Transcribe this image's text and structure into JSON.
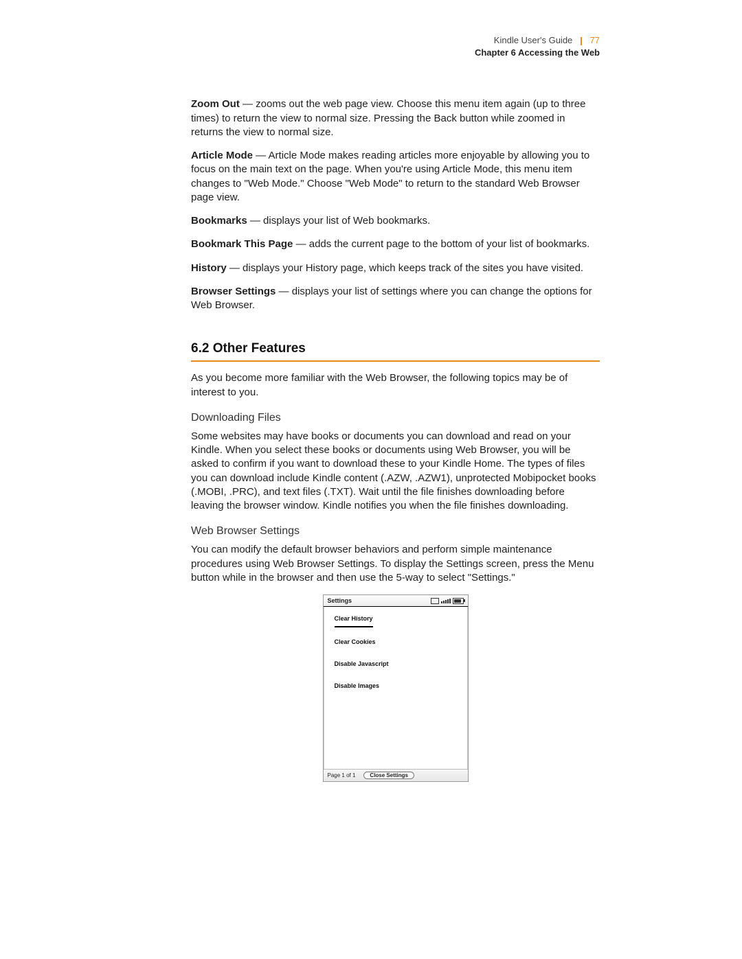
{
  "header": {
    "guide": "Kindle User's Guide",
    "page_number": "77",
    "chapter": "Chapter 6 Accessing the Web"
  },
  "definitions": {
    "zoom_out": {
      "term": "Zoom Out",
      "text": " — zooms out the web page view. Choose this menu item again (up to three times) to return the view to normal size. Pressing the Back button while zoomed in returns the view to normal size."
    },
    "article_mode": {
      "term": "Article Mode",
      "text": " — Article Mode makes reading articles more enjoyable by allowing you to focus on the main text on the page. When you're using Article Mode, this menu item changes to \"Web Mode.\" Choose \"Web Mode\" to return to the standard Web Browser page view."
    },
    "bookmarks": {
      "term": "Bookmarks",
      "text": " — displays your list of Web bookmarks."
    },
    "bookmark_this": {
      "term": "Bookmark This Page",
      "text": " — adds the current page to the bottom of your list of bookmarks."
    },
    "history": {
      "term": "History",
      "text": " — displays your History page, which keeps track of the sites you have visited."
    },
    "browser_settings": {
      "term": "Browser Settings",
      "text": " — displays your list of settings where you can change the options for Web Browser."
    }
  },
  "section": {
    "title": "6.2 Other Features",
    "intro": "As you become more familiar with the Web Browser, the following topics may be of interest to you.",
    "downloading": {
      "heading": "Downloading Files",
      "body": "Some websites may have books or documents you can download and read on your Kindle. When you select these books or documents using Web Browser, you will be asked to confirm if you want to download these to your Kindle Home. The types of files you can download include Kindle content (.AZW, .AZW1), unprotected Mobipocket books (.MOBI, .PRC), and text files (.TXT). Wait until the file finishes downloading before leaving the browser window. Kindle notifies you when the file finishes downloading."
    },
    "settings": {
      "heading": "Web Browser Settings",
      "body": "You can modify the default browser behaviors and perform simple maintenance procedures using Web Browser Settings. To display the Settings screen, press the Menu button while in the browser and then use the 5-way to select \"Settings.\""
    }
  },
  "kindle_screen": {
    "title": "Settings",
    "items": [
      "Clear History",
      "Clear Cookies",
      "Disable Javascript",
      "Disable Images"
    ],
    "footer_page": "Page 1 of 1",
    "footer_button": "Close Settings"
  }
}
